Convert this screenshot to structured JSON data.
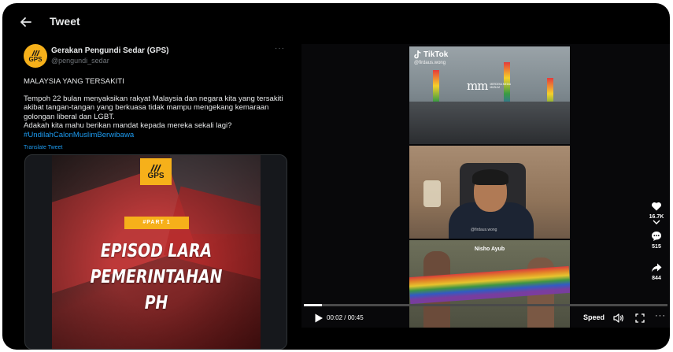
{
  "header": {
    "title": "Tweet"
  },
  "tweet": {
    "author_name": "Gerakan Pengundi Sedar (GPS)",
    "author_handle": "@pengundi_sedar",
    "avatar_text": "GPS",
    "more_label": "···",
    "text_heading": "MALAYSIA YANG TERSAKITI",
    "text_body_1": "Tempoh 22 bulan menyaksikan rakyat Malaysia dan negara kita yang tersakiti akibat tangan-tangan yang berkuasa tidak mampu mengekang kemaraan golongan liberal dan LGBT.",
    "text_body_2": "Adakah kita mahu berikan mandat kepada mereka sekali lagi?",
    "hashtag": "#UndilahCalonMuslimBerwibawa",
    "translate_label": "Translate Tweet"
  },
  "poster": {
    "logo_text": "GPS",
    "part_badge": "#PART 1",
    "headline_line1": "EPISOD LARA",
    "headline_line2": "PEMERINTAHAN",
    "headline_line3": "PH"
  },
  "video": {
    "brand": "TikTok",
    "username": "@firdaus.wong",
    "org_logo_mark": "mm",
    "org_logo_words": "MERDEKA MEDIA MUSLIM",
    "watermark": "@firdaus.wong",
    "caption_name": "Nisho Ayub",
    "likes": "16.7K",
    "comments": "515",
    "shares": "844",
    "time": "00:02 / 00:45",
    "progress": 0.05,
    "speed_label": "Speed"
  },
  "colors": {
    "accent": "#1d9bf0",
    "brand_yellow": "#f6b01a",
    "background": "#000000"
  },
  "icons": {
    "back": "arrow-left-icon",
    "play": "play-icon",
    "volume": "volume-icon",
    "fullscreen": "fullscreen-icon",
    "like": "heart-icon",
    "comment": "comment-icon",
    "share": "share-icon"
  }
}
